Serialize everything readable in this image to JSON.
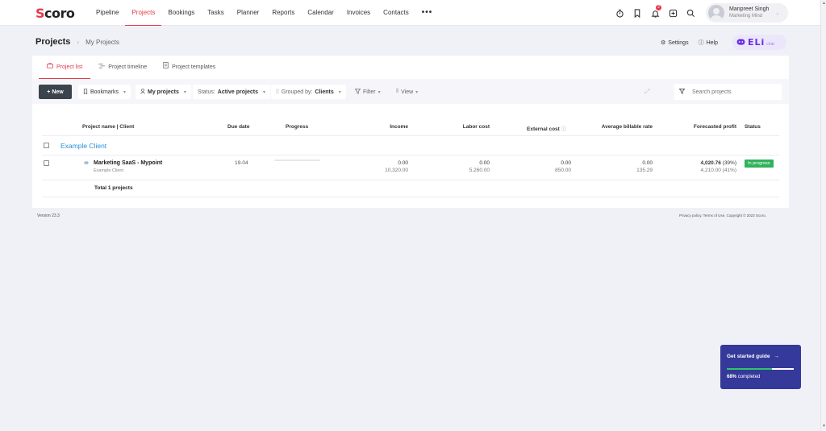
{
  "app": {
    "logo_text": "Scoro"
  },
  "nav": {
    "items": [
      "Pipeline",
      "Projects",
      "Bookings",
      "Tasks",
      "Planner",
      "Reports",
      "Calendar",
      "Invoices",
      "Contacts"
    ],
    "active": "Projects",
    "more": "•••",
    "notifications_count": "2"
  },
  "user": {
    "name": "Manpreet Singh",
    "org": "Marketing Mind"
  },
  "header": {
    "title": "Projects",
    "breadcrumb": "My Projects",
    "settings_label": "Settings",
    "help_label": "Help",
    "eli_label": "ELi",
    "eli_sub": "chat"
  },
  "tabs": [
    {
      "label": "Project list",
      "icon": "briefcase-icon",
      "active": true
    },
    {
      "label": "Project timeline",
      "icon": "timeline-icon",
      "active": false
    },
    {
      "label": "Project templates",
      "icon": "template-icon",
      "active": false
    }
  ],
  "toolbar": {
    "new_label": "+ New",
    "bookmarks_label": "Bookmarks",
    "my_projects_label": "My projects",
    "status_prefix": "Status:",
    "status_value": "Active projects",
    "grouped_prefix": "Grouped by:",
    "grouped_value": "Clients",
    "filter_label": "Filter",
    "view_label": "View",
    "search_placeholder": "Search projects"
  },
  "table": {
    "headers": {
      "project_client": "Project name | Client",
      "due_date": "Due date",
      "progress": "Progress",
      "income": "Income",
      "labor_cost": "Labor cost",
      "external_cost": "External cost",
      "avg_rate": "Average billable rate",
      "forecasted_profit": "Forecasted profit",
      "status": "Status"
    },
    "group": "Example Client",
    "rows": [
      {
        "name": "Marketing SaaS - Mypoint",
        "client": "Example Client",
        "due_date": "19-04",
        "progress_fraction": 0.0,
        "income_top": "0.00",
        "income_bottom": "10,320.00",
        "labor_top": "0.00",
        "labor_bottom": "5,260.00",
        "external_top": "0.00",
        "external_bottom": "850.00",
        "rate_top": "0.00",
        "rate_bottom": "135.29",
        "profit_top_value": "4,020.76",
        "profit_top_pct": "(39%)",
        "profit_bottom": "4,210.00 (41%)",
        "status": "In progress"
      }
    ],
    "total_label": "Total 1 projects"
  },
  "footer": {
    "version": "Version 23.3",
    "legal": "Privacy policy. Terms of Use. Copyright © 2023 Scoro."
  },
  "guide": {
    "title": "Get started guide",
    "arrow": "→",
    "percent": "68%",
    "completed_label": "completed",
    "progress_fraction": 0.68
  },
  "colors": {
    "accent": "#e5394a",
    "primary_dark": "#3b434d",
    "link": "#2a8fd8",
    "status_green": "#30b25c",
    "guide_bg": "#34399a"
  }
}
